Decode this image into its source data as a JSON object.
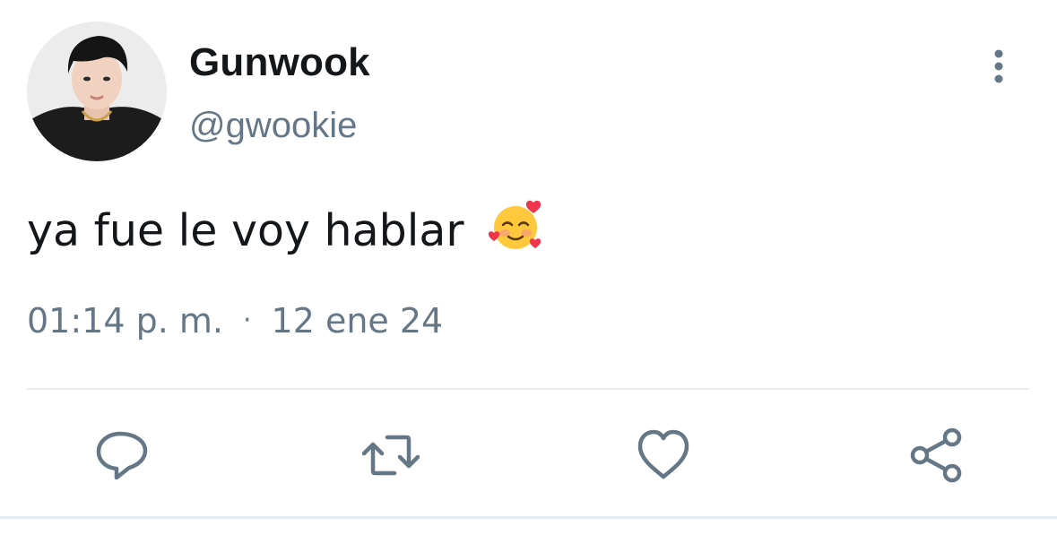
{
  "tweet": {
    "author": {
      "display_name": "Gunwook",
      "handle": "@gwookie",
      "avatar": "profile-photo"
    },
    "text": "ya fue le voy hablar",
    "emoji": "smiling-face-with-hearts",
    "time": "01:14 p. m.",
    "separator": "·",
    "date": "12 ene 24"
  },
  "actions": [
    {
      "icon": "reply-icon"
    },
    {
      "icon": "retweet-icon"
    },
    {
      "icon": "like-icon"
    },
    {
      "icon": "share-icon"
    }
  ],
  "colors": {
    "text": "#14171a",
    "muted": "#657786",
    "icon": "#657786",
    "divider": "#e6ecf0",
    "background": "#ffffff"
  }
}
